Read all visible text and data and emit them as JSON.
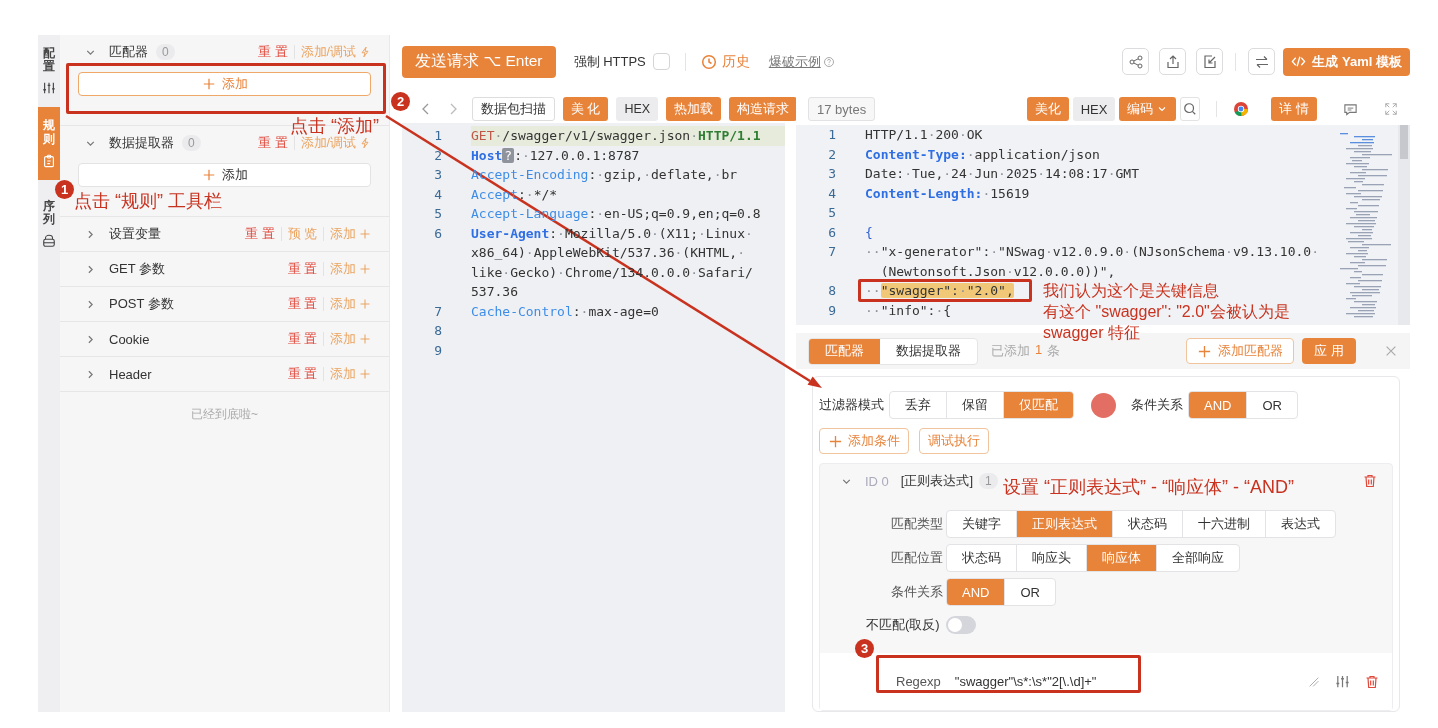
{
  "side_tabs": [
    {
      "label": "配置",
      "selected": false
    },
    {
      "label": "规则",
      "selected": true
    },
    {
      "label": "序列",
      "selected": false
    }
  ],
  "rule_sections": [
    {
      "kind": "block",
      "title": "匹配器",
      "count": "0",
      "expanded": true,
      "actions": [
        {
          "label": "重 置",
          "kind": "reset"
        },
        {
          "label": "添加/调试",
          "kind": "debug"
        }
      ],
      "add_button": "添加",
      "focused": true
    },
    {
      "kind": "block",
      "title": "数据提取器",
      "count": "0",
      "expanded": true,
      "actions": [
        {
          "label": "重 置",
          "kind": "reset"
        },
        {
          "label": "添加/调试",
          "kind": "debug"
        }
      ],
      "add_button": "添加",
      "focused": false
    },
    {
      "kind": "row",
      "title": "设置变量",
      "expanded": false,
      "actions": [
        {
          "label": "重 置",
          "kind": "reset"
        },
        {
          "label": "预 览",
          "kind": "preview"
        },
        {
          "label": "添加",
          "kind": "add"
        }
      ]
    },
    {
      "kind": "row",
      "title": "GET 参数",
      "expanded": false,
      "actions": [
        {
          "label": "重 置",
          "kind": "reset"
        },
        {
          "label": "添加",
          "kind": "add"
        }
      ]
    },
    {
      "kind": "row",
      "title": "POST 参数",
      "expanded": false,
      "actions": [
        {
          "label": "重 置",
          "kind": "reset"
        },
        {
          "label": "添加",
          "kind": "add"
        }
      ]
    },
    {
      "kind": "row",
      "title": "Cookie",
      "expanded": false,
      "actions": [
        {
          "label": "重 置",
          "kind": "reset"
        },
        {
          "label": "添加",
          "kind": "add"
        }
      ]
    },
    {
      "kind": "row",
      "title": "Header",
      "expanded": false,
      "actions": [
        {
          "label": "重 置",
          "kind": "reset"
        },
        {
          "label": "添加",
          "kind": "add"
        }
      ]
    }
  ],
  "rules_footer": "已经到底啦~",
  "toolbar": {
    "send_button": "发送请求 ⌥ Enter",
    "force_https": {
      "label": "强制 HTTPS",
      "checked": false
    },
    "history": "历史",
    "example_link": "爆破示例",
    "generate_button": "生成 Yaml 模板"
  },
  "request": {
    "buttons": [
      {
        "label": "数据包扫描",
        "kind": "plain"
      },
      {
        "label": "美 化",
        "kind": "primary"
      },
      {
        "label": "HEX",
        "kind": "gray"
      },
      {
        "label": "热加载",
        "kind": "primary"
      },
      {
        "label": "构造请求",
        "kind": "primary"
      }
    ],
    "lines": [
      {
        "number": "1",
        "highlighted": true,
        "tokens": [
          {
            "text": "GET",
            "kind": "method"
          },
          {
            "text": "·/swagger/v1/swagger.json·",
            "kind": "plain"
          },
          {
            "text": "HTTP/1.1",
            "kind": "version"
          }
        ]
      },
      {
        "number": "2",
        "highlighted": false,
        "tokens": [
          {
            "text": "Host",
            "kind": "key"
          },
          {
            "text": "?",
            "kind": "badge"
          },
          {
            "text": ":·127.0.0.1:8787",
            "kind": "plain"
          }
        ]
      },
      {
        "number": "3",
        "highlighted": false,
        "tokens": [
          {
            "text": "Accept-Encoding",
            "kind": "attr"
          },
          {
            "text": ":·gzip,·deflate,·br",
            "kind": "plain"
          }
        ]
      },
      {
        "number": "4",
        "highlighted": false,
        "tokens": [
          {
            "text": "Accept",
            "kind": "attr"
          },
          {
            "text": ":·*/*",
            "kind": "plain"
          }
        ]
      },
      {
        "number": "5",
        "highlighted": false,
        "tokens": [
          {
            "text": "Accept-Language",
            "kind": "attr"
          },
          {
            "text": ":·en-US;q=0.9,en;q=0.8",
            "kind": "plain"
          }
        ]
      },
      {
        "number": "6",
        "highlighted": false,
        "tokens": [
          {
            "text": "User-Agent",
            "kind": "key"
          },
          {
            "text": ":·Mozilla/5.0·(X11;·Linux·",
            "kind": "plain"
          }
        ]
      },
      {
        "highlighted": false,
        "tokens": [
          {
            "text": "x86_64)·AppleWebKit/537.36·(KHTML,·",
            "kind": "plain"
          }
        ]
      },
      {
        "highlighted": false,
        "tokens": [
          {
            "text": "like·Gecko)·Chrome/134.0.0.0·Safari/",
            "kind": "plain"
          }
        ]
      },
      {
        "highlighted": false,
        "tokens": [
          {
            "text": "537.36",
            "kind": "plain"
          }
        ]
      },
      {
        "number": "7",
        "highlighted": false,
        "tokens": [
          {
            "text": "Cache-Control",
            "kind": "attr"
          },
          {
            "text": ":·max-age=0",
            "kind": "plain"
          }
        ]
      },
      {
        "number": "8",
        "highlighted": false
      },
      {
        "number": "9",
        "highlighted": false
      }
    ]
  },
  "response": {
    "size": "17 bytes",
    "beautify_button": "美化",
    "hex_button": "HEX",
    "encoding_button": "编码",
    "detail_button": "详 情",
    "lines": [
      {
        "number": "1",
        "tokens": [
          {
            "text": "HTTP/1.1·200·OK",
            "kind": "plain"
          }
        ]
      },
      {
        "number": "2",
        "tokens": [
          {
            "text": "Content-Type:",
            "kind": "key"
          },
          {
            "text": "·application/json",
            "kind": "plain"
          }
        ]
      },
      {
        "number": "3",
        "tokens": [
          {
            "text": "Date:·Tue,·24·Jun·2025·14:08:17·GMT",
            "kind": "plain"
          }
        ]
      },
      {
        "number": "4",
        "tokens": [
          {
            "text": "Content-Length:",
            "kind": "key"
          },
          {
            "text": "·15619",
            "kind": "plain"
          }
        ]
      },
      {
        "number": "5"
      },
      {
        "number": "6",
        "tokens": [
          {
            "text": "{",
            "kind": "brace"
          }
        ]
      },
      {
        "number": "7",
        "tokens": [
          {
            "text": "··\"x-generator\":·\"NSwag·v12.0.9.0·(NJsonSchema·v9.13.10.0·",
            "kind": "plain"
          }
        ]
      },
      {
        "continued": true,
        "tokens": [
          {
            "text": "(Newtonsoft.Json·v12.0.0.0))\",",
            "kind": "plain"
          }
        ]
      },
      {
        "number": "8",
        "tokens": [
          {
            "text": "··",
            "kind": "plain"
          },
          {
            "text": "\"swagger\":·\"2.0\",",
            "kind": "mark"
          }
        ]
      },
      {
        "number": "9",
        "tokens": [
          {
            "text": "··\"info\":·{",
            "kind": "plain"
          }
        ]
      }
    ]
  },
  "matcher": {
    "tabs": [
      {
        "label": "匹配器",
        "selected": true
      },
      {
        "label": "数据提取器",
        "selected": false
      }
    ],
    "added": {
      "prefix": "已添加",
      "count": "1",
      "suffix": "条"
    },
    "add_matcher_button": "添加匹配器",
    "apply_button": "应 用",
    "filter_mode": {
      "label": "过滤器模式",
      "options": [
        {
          "label": "丢弃",
          "selected": false
        },
        {
          "label": "保留",
          "selected": false
        },
        {
          "label": "仅匹配",
          "selected": true
        }
      ]
    },
    "color": "#e36f64",
    "relation": {
      "label": "条件关系",
      "options": [
        {
          "label": "AND",
          "selected": true
        },
        {
          "label": "OR",
          "selected": false
        }
      ]
    },
    "add_condition_button": "添加条件",
    "debug_button": "调试执行",
    "condition": {
      "id": "ID 0",
      "type": "[正则表达式]",
      "count": "1",
      "expanded": true,
      "fields": [
        {
          "label": "匹配类型",
          "options": [
            {
              "label": "关键字",
              "selected": false
            },
            {
              "label": "正则表达式",
              "selected": true
            },
            {
              "label": "状态码",
              "selected": false
            },
            {
              "label": "十六进制",
              "selected": false
            },
            {
              "label": "表达式",
              "selected": false
            }
          ]
        },
        {
          "label": "匹配位置",
          "options": [
            {
              "label": "状态码",
              "selected": false
            },
            {
              "label": "响应头",
              "selected": false
            },
            {
              "label": "响应体",
              "selected": true
            },
            {
              "label": "全部响应",
              "selected": false
            }
          ]
        },
        {
          "label": "条件关系",
          "options": [
            {
              "label": "AND",
              "selected": true
            },
            {
              "label": "OR",
              "selected": false
            }
          ]
        }
      ],
      "negate": {
        "label": "不匹配(取反)",
        "on": false
      },
      "rules": [
        {
          "name": "Regexp",
          "value": "\"swagger\"\\s*:\\s*\"2[\\.\\d]+\""
        }
      ]
    }
  },
  "annotations": {
    "steps": [
      "1",
      "2",
      "3"
    ],
    "notes": [
      {
        "lines": [
          "点击 “添加”"
        ]
      },
      {
        "lines": [
          "点击 “规则” 工具栏"
        ]
      },
      {
        "lines": [
          "我们认为这个是关键信息",
          "有这个 \"swagger\": \"2.0\"会被认为是",
          "swagger 特征"
        ]
      },
      {
        "lines": [
          "设置 “正则表达式” - “响应体” - “AND”"
        ]
      }
    ]
  }
}
